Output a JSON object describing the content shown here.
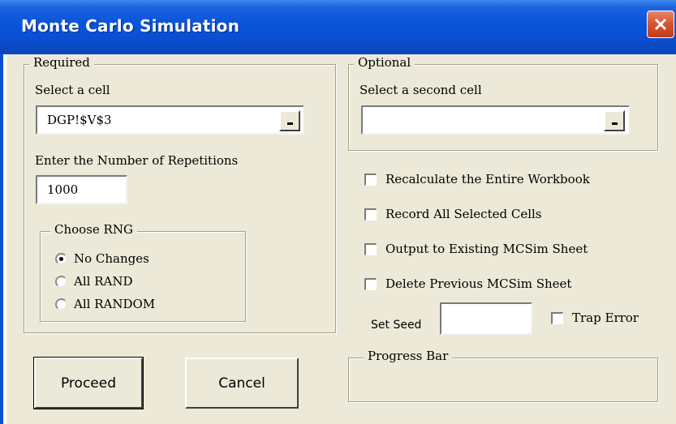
{
  "window": {
    "title": "Monte Carlo Simulation"
  },
  "required": {
    "legend": "Required",
    "select_cell_label": "Select a cell",
    "cell_value": "DGP!$V$3",
    "repetitions_label": "Enter the Number of Repetitions",
    "repetitions_value": "1000",
    "rng": {
      "legend": "Choose RNG",
      "options": [
        "No Changes",
        "All RAND",
        "All RANDOM"
      ],
      "selected": "No Changes"
    }
  },
  "optional": {
    "legend": "Optional",
    "select_second_label": "Select a second cell",
    "second_cell_value": ""
  },
  "options": {
    "recalculate": {
      "label": "Recalculate the Entire Workbook",
      "checked": false
    },
    "record_all": {
      "label": "Record All Selected Cells",
      "checked": false
    },
    "output_existing": {
      "label": "Output to Existing MCSim Sheet",
      "checked": false
    },
    "delete_previous": {
      "label": "Delete Previous MCSim Sheet",
      "checked": false
    }
  },
  "seed": {
    "label": "Set Seed",
    "value": ""
  },
  "trap_error": {
    "label": "Trap Error",
    "checked": false
  },
  "progress": {
    "legend": "Progress Bar"
  },
  "buttons": {
    "proceed": "Proceed",
    "cancel": "Cancel"
  },
  "icons": {
    "close": "close-icon",
    "ref_edit": "ref-edit-icon"
  },
  "colors": {
    "titlebar": "#0a4fd3",
    "face": "#ece9d8",
    "close": "#d8532f"
  }
}
